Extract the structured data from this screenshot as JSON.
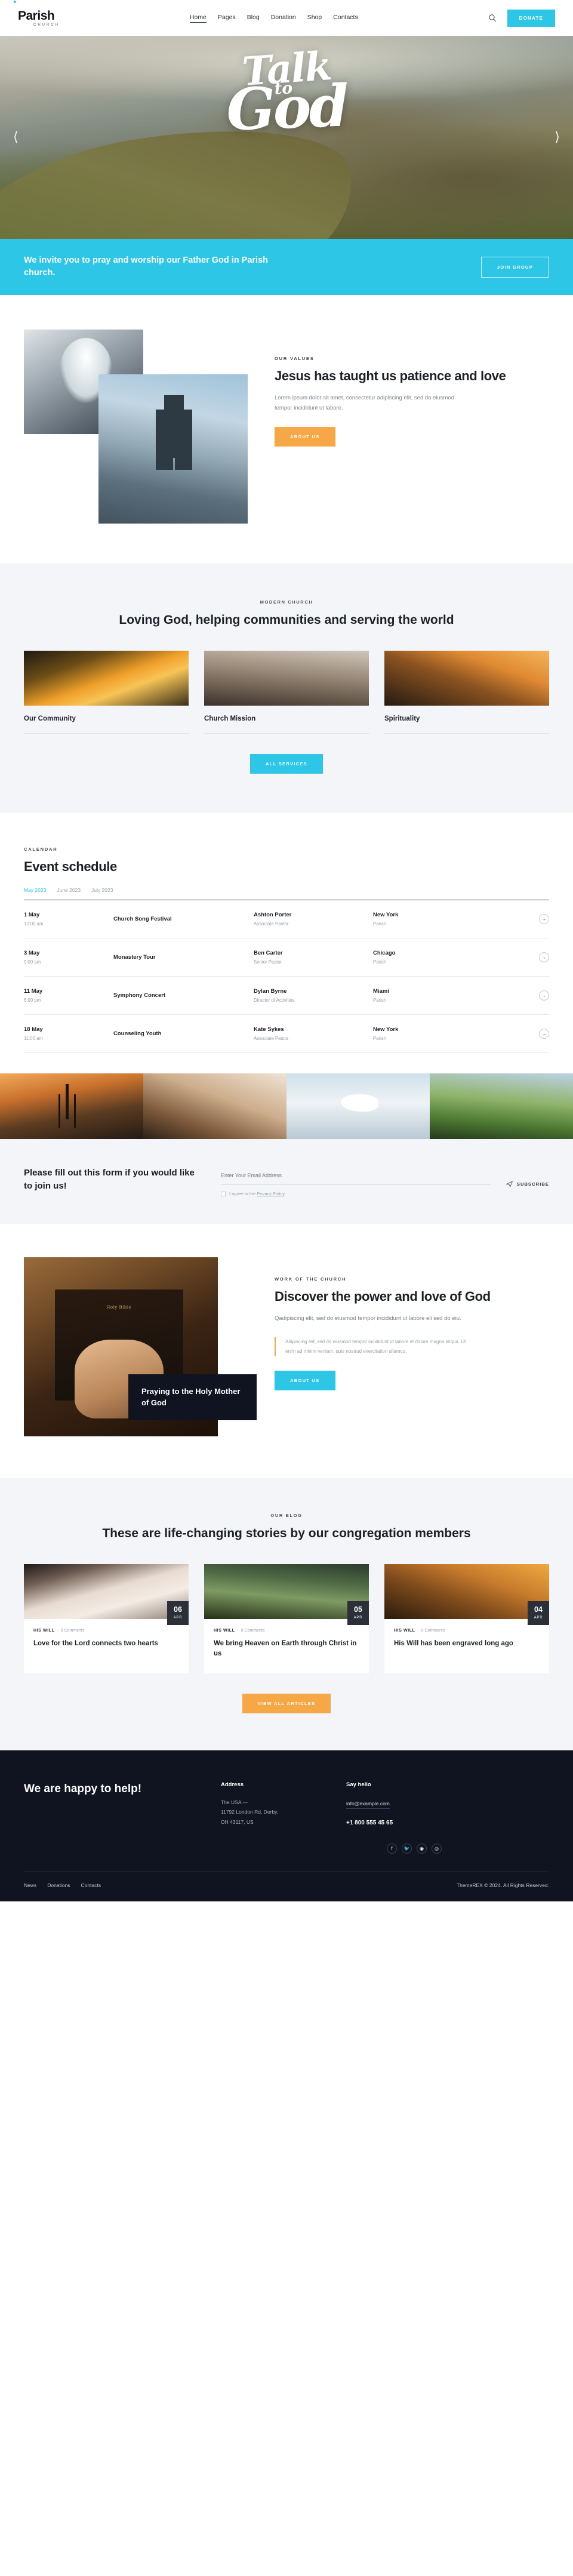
{
  "header": {
    "logo_word": "Parish",
    "logo_sub": "CHURCH",
    "nav": [
      {
        "label": "Home",
        "active": true
      },
      {
        "label": "Pages",
        "active": false
      },
      {
        "label": "Blog",
        "active": false
      },
      {
        "label": "Donation",
        "active": false
      },
      {
        "label": "Shop",
        "active": false
      },
      {
        "label": "Contacts",
        "active": false
      }
    ],
    "search_icon": "search-icon",
    "donate_label": "DONATE"
  },
  "hero": {
    "line1": "Talk",
    "line2": "to",
    "line3": "God",
    "prev_icon": "chevron-left-icon",
    "next_icon": "chevron-right-icon"
  },
  "cta": {
    "text": "We invite you to pray and worship our Father God in Parish church.",
    "button": "JOIN GROUP"
  },
  "values": {
    "eyebrow": "OUR VALUES",
    "heading": "Jesus has taught us patience and love",
    "paragraph": "Lorem ipsum dolor sit amet, consectetur adipiscing elit, sed do eiusmod tempor incididunt ut labore.",
    "button": "ABOUT US"
  },
  "services": {
    "eyebrow": "MODERN CHURCH",
    "heading": "Loving God, helping communities and serving the world",
    "cards": [
      {
        "title": "Our Community"
      },
      {
        "title": "Church Mission"
      },
      {
        "title": "Spirituality"
      }
    ],
    "button": "ALL SERVICES"
  },
  "events": {
    "eyebrow": "CALENDAR",
    "heading": "Event schedule",
    "tabs": [
      {
        "label": "May 2023",
        "active": true
      },
      {
        "label": "June 2023",
        "active": false
      },
      {
        "label": "July 2023",
        "active": false
      }
    ],
    "rows": [
      {
        "date": "1 May",
        "time": "12:00 am",
        "name": "Church Song Festival",
        "person": "Ashton Porter",
        "role": "Associate Pastor",
        "city": "New York",
        "place": "Parish",
        "go_icon": "arrow-right-icon"
      },
      {
        "date": "3 May",
        "time": "9:00 am",
        "name": "Monastery Tour",
        "person": "Ben Carter",
        "role": "Senior Pastor",
        "city": "Chicago",
        "place": "Parish",
        "go_icon": "arrow-right-icon"
      },
      {
        "date": "11 May",
        "time": "6:00 pm",
        "name": "Symphony Concert",
        "person": "Dylan Byrne",
        "role": "Director of Activities",
        "city": "Miami",
        "place": "Parish",
        "go_icon": "arrow-right-icon"
      },
      {
        "date": "18 May",
        "time": "11:00 am",
        "name": "Counseling Youth",
        "person": "Kate Sykes",
        "role": "Associate Pastor",
        "city": "New York",
        "place": "Parish",
        "go_icon": "arrow-right-icon"
      }
    ]
  },
  "subscribe": {
    "title": "Please fill out this form if you would like to join us!",
    "placeholder": "Enter Your Email Address",
    "value": "",
    "consent_prefix": "I agree to the ",
    "consent_link": "Privacy Policy",
    "consent_suffix": ".",
    "button": "SUBSCRIBE",
    "button_icon": "paper-plane-icon"
  },
  "power": {
    "eyebrow": "WORK OF THE CHURCH",
    "heading": "Discover the power and love of God",
    "paragraph": "Qadipiscing elit, sed do eiusmod tempor incididunt ut labore eli sed do eiu.",
    "quote": "Adipiscing elit, sed do eiusmod tempor incididunt ut labore et dolore magna aliqua. Ut enim ad minim veniam, quis nostrud exercitation ullamco.",
    "button": "ABOUT US",
    "image_caption": "Praying to the Holy Mother of God",
    "book_label": "Holy Bible"
  },
  "blog": {
    "eyebrow": "OUR BLOG",
    "heading": "These are life-changing stories by our congregation members",
    "posts": [
      {
        "category": "HIS WILL",
        "comments": "0 Comments",
        "title": "Love for the Lord connects two hearts",
        "day": "06",
        "month": "APR"
      },
      {
        "category": "HIS WILL",
        "comments": "0 Comments",
        "title": "We bring Heaven on Earth through Christ in us",
        "day": "05",
        "month": "APR"
      },
      {
        "category": "HIS WILL",
        "comments": "0 Comments",
        "title": "His Will has been engraved long ago",
        "day": "04",
        "month": "APR"
      }
    ],
    "button": "VIEW ALL ARTICLES"
  },
  "footer": {
    "title": "We are happy to help!",
    "address_heading": "Address",
    "address_line1": "The USA  —",
    "address_line2": "11792 London Rd, Derby,",
    "address_line3": "OH 43117, US",
    "hello_heading": "Say hello",
    "email": "info@example.com",
    "phone": "+1 800 555 45 65",
    "social": [
      {
        "icon": "facebook-icon",
        "glyph": "f"
      },
      {
        "icon": "twitter-icon",
        "glyph": "🐦"
      },
      {
        "icon": "dribbble-icon",
        "glyph": "◉"
      },
      {
        "icon": "instagram-icon",
        "glyph": "◎"
      }
    ],
    "links": [
      {
        "label": "News"
      },
      {
        "label": "Donations"
      },
      {
        "label": "Contacts"
      }
    ],
    "copyright": "ThemeREX © 2024. All Rights Reserved."
  },
  "colors": {
    "accent_cyan": "#2ec6e6",
    "accent_orange": "#f7a846",
    "dark": "#0f1420",
    "light_bg": "#f4f5f9"
  }
}
